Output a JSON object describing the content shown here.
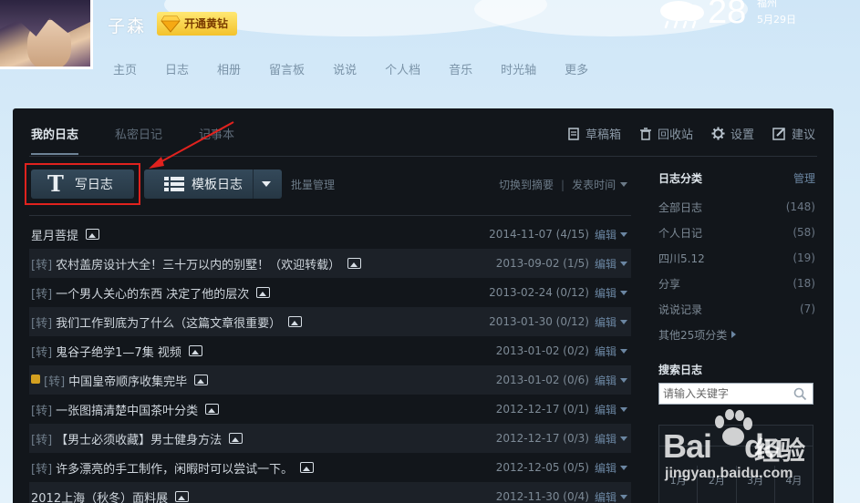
{
  "header": {
    "username": "子森",
    "vip_label": "开通黄钻",
    "weather": {
      "temperature": "28",
      "city": "福州",
      "date": "5月29日"
    },
    "nav": [
      "主页",
      "日志",
      "相册",
      "留言板",
      "说说",
      "个人档",
      "音乐",
      "时光轴",
      "更多"
    ]
  },
  "tabs": [
    {
      "label": "我的日志",
      "active": true
    },
    {
      "label": "私密日记",
      "active": false
    },
    {
      "label": "记事本",
      "active": false
    }
  ],
  "toolbar": {
    "drafts": "草稿箱",
    "recycle": "回收站",
    "settings": "设置",
    "suggest": "建议",
    "write_label": "写日志",
    "template_label": "模板日志",
    "batch_label": "批量管理",
    "switch_summary": "切换到摘要",
    "sort_label": "发表时间"
  },
  "diaries": [
    {
      "repost": "",
      "locked": false,
      "title": "星月菩提",
      "date": "2014-11-07",
      "stats": "(4/15)",
      "edit": "编辑"
    },
    {
      "repost": "[转]",
      "locked": false,
      "title": "农村盖房设计大全！三十万以内的别墅！（欢迎转载）",
      "date": "2013-09-02",
      "stats": "(1/5)",
      "edit": "编辑"
    },
    {
      "repost": "[转]",
      "locked": false,
      "title": "一个男人关心的东西 决定了他的层次",
      "date": "2013-02-24",
      "stats": "(0/12)",
      "edit": "编辑"
    },
    {
      "repost": "[转]",
      "locked": false,
      "title": "我们工作到底为了什么（这篇文章很重要）",
      "date": "2013-01-30",
      "stats": "(0/12)",
      "edit": "编辑"
    },
    {
      "repost": "[转]",
      "locked": false,
      "title": "鬼谷子绝学1—7集 视频",
      "date": "2013-01-02",
      "stats": "(0/2)",
      "edit": "编辑"
    },
    {
      "repost": "[转]",
      "locked": true,
      "title": "中国皇帝顺序收集完毕",
      "date": "2013-01-02",
      "stats": "(0/6)",
      "edit": "编辑"
    },
    {
      "repost": "[转]",
      "locked": false,
      "title": "一张图搞清楚中国茶叶分类",
      "date": "2012-12-17",
      "stats": "(0/1)",
      "edit": "编辑"
    },
    {
      "repost": "[转]",
      "locked": false,
      "title": "【男士必须收藏】男士健身方法",
      "date": "2012-12-17",
      "stats": "(0/3)",
      "edit": "编辑"
    },
    {
      "repost": "[转]",
      "locked": false,
      "title": "许多漂亮的手工制作，闲暇时可以尝试一下。",
      "date": "2012-12-05",
      "stats": "(0/5)",
      "edit": "编辑"
    },
    {
      "repost": "",
      "locked": false,
      "title": "2012上海（秋冬）面料展",
      "date": "2012-11-30",
      "stats": "(0/4)",
      "edit": "编辑"
    }
  ],
  "sidebar": {
    "title": "日志分类",
    "manage": "管理",
    "categories": [
      {
        "name": "全部日志",
        "count": "(148)"
      },
      {
        "name": "个人日记",
        "count": "(58)"
      },
      {
        "name": "四川5.12",
        "count": "(19)"
      },
      {
        "name": "分享",
        "count": "(18)"
      },
      {
        "name": "说说记录",
        "count": "(7)"
      }
    ],
    "more": "其他25项分类",
    "search_title": "搜索日志",
    "search_placeholder": "请输入关键字",
    "calendar_days": [
      "1月",
      "2月",
      "3月",
      "4月"
    ]
  },
  "watermark": {
    "brand": "Bai",
    "brand2": "du",
    "cn": "经验",
    "sub": "jingyan.baidu.com"
  },
  "colors": {
    "panel": "#12161b",
    "accent": "#6b86a2",
    "highlight": "#e0221e",
    "vip": "#f3c22c"
  }
}
